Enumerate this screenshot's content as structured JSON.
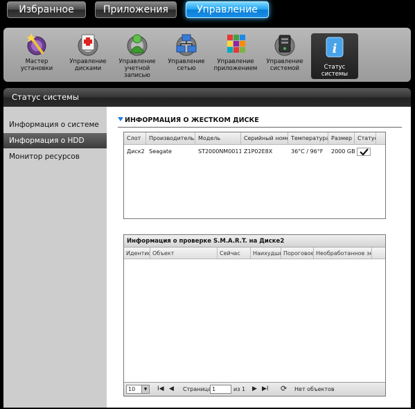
{
  "top_tabs": [
    "Избранное",
    "Приложения",
    "Управление"
  ],
  "toolbar": [
    {
      "label": "Мастер установки",
      "icon": "wizard-icon"
    },
    {
      "label": "Управление дисками",
      "icon": "disk-management-icon"
    },
    {
      "label": "Управление учетной записью",
      "icon": "account-management-icon"
    },
    {
      "label": "Управление сетью",
      "icon": "network-management-icon"
    },
    {
      "label": "Управление приложением",
      "icon": "app-management-icon"
    },
    {
      "label": "Управление системой",
      "icon": "system-management-icon"
    },
    {
      "label": "Статус системы",
      "icon": "info-icon"
    }
  ],
  "section_header": "Статус системы",
  "sidebar": [
    {
      "label": "Информация о системе"
    },
    {
      "label": "Информация о HDD",
      "active": true
    },
    {
      "label": "Монитор ресурсов"
    }
  ],
  "hdd": {
    "title": "ИНФОРМАЦИЯ О ЖЕСТКОМ ДИСКЕ",
    "columns": [
      "Слот",
      "Производитель",
      "Модель",
      "Серийный номер",
      "Температура",
      "Размер",
      "Статус"
    ],
    "rows": [
      [
        "Диск2",
        "Seagate",
        "ST2000NM0011",
        "Z1P02E8X",
        "36°C / 96°F",
        "2000 GB",
        ""
      ]
    ]
  },
  "smart": {
    "title": "Информация о проверке S.M.A.R.T. на Диске2",
    "columns": [
      "Идентиф",
      "Объект",
      "Сейчас",
      "Наихудшие",
      "Пороговое",
      "Необработанное зна"
    ]
  },
  "pager": {
    "page_size": "10",
    "page_label": "Страница",
    "page_value": "1",
    "of_label": "из 1",
    "empty": "Нет объектов"
  },
  "colors": {
    "accent_blue": "#1aa0f0",
    "active_dark": "#222222"
  }
}
